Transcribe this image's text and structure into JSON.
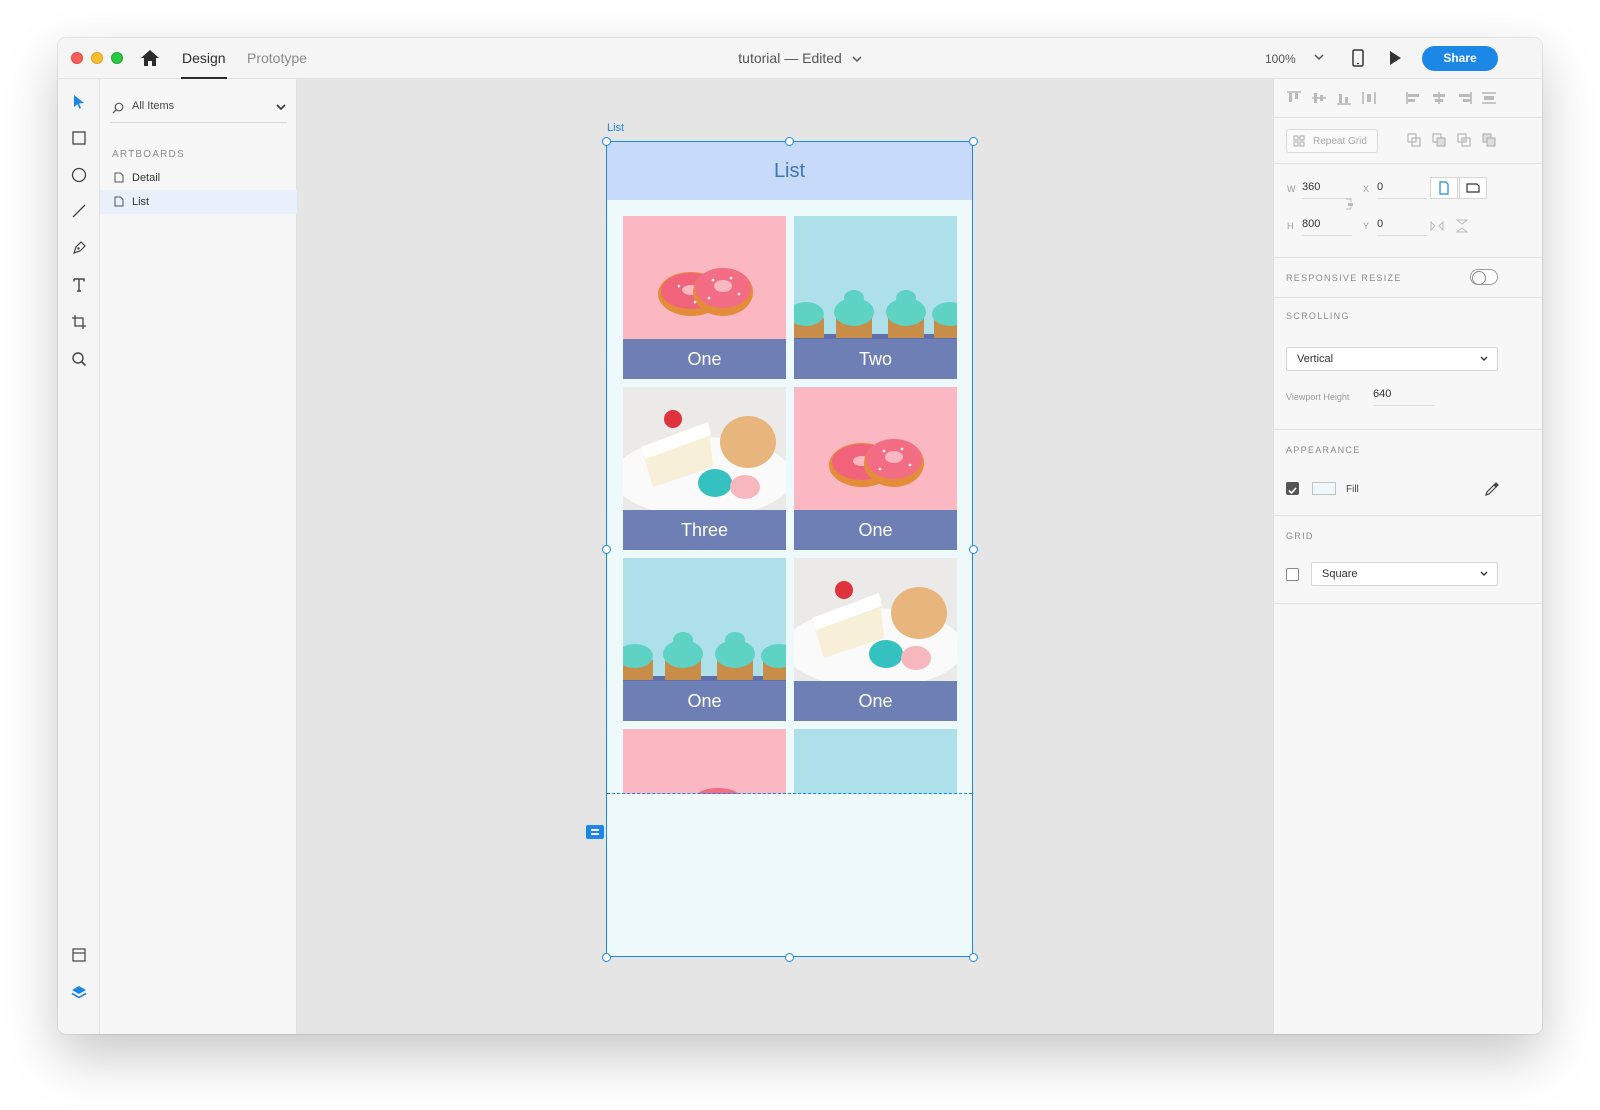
{
  "titlebar": {
    "tabs": {
      "design": "Design",
      "prototype": "Prototype"
    },
    "document_name": "tutorial",
    "separator": "—",
    "document_status": "Edited",
    "zoom": "100%",
    "share_label": "Share"
  },
  "layers": {
    "filter_label": "All Items",
    "section_label": "ARTBOARDS",
    "artboards": [
      "Detail",
      "List"
    ],
    "selected_artboard": "List"
  },
  "canvas": {
    "artboard_label": "List",
    "header_title": "List",
    "cells": [
      {
        "caption": "One",
        "image": "donuts-image"
      },
      {
        "caption": "Two",
        "image": "cupcakes-image"
      },
      {
        "caption": "Three",
        "image": "cake-macarons-image"
      },
      {
        "caption": "One",
        "image": "donuts-image"
      },
      {
        "caption": "One",
        "image": "cupcakes-image"
      },
      {
        "caption": "One",
        "image": "cake-macarons-image"
      }
    ],
    "colors": {
      "header_bg": "#c8dafa",
      "header_text": "#3c76b8",
      "caption_bg": "#6d7fb5",
      "selection": "#1b87e6",
      "artboard_fill": "#eef9fc"
    }
  },
  "inspector": {
    "repeat_grid_label": "Repeat Grid",
    "w_label": "W",
    "w_value": "360",
    "h_label": "H",
    "h_value": "800",
    "x_label": "X",
    "x_value": "0",
    "y_label": "Y",
    "y_value": "0",
    "responsive_resize_label": "RESPONSIVE RESIZE",
    "scrolling_label": "SCROLLING",
    "scrolling_value": "Vertical",
    "viewport_height_label": "Viewport Height",
    "viewport_height_value": "640",
    "appearance_label": "APPEARANCE",
    "fill_label": "Fill",
    "grid_label": "GRID",
    "grid_value": "Square"
  }
}
